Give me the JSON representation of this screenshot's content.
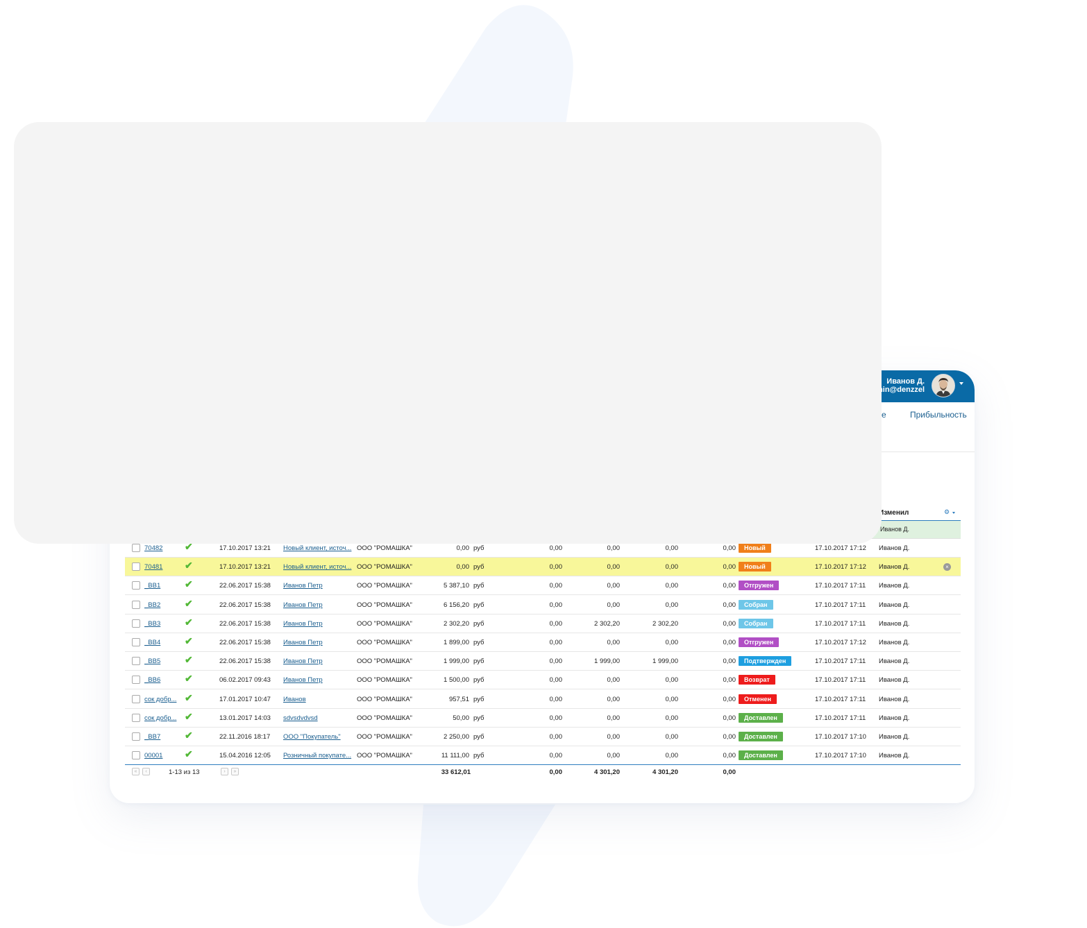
{
  "user": {
    "name": "Иванов Д.",
    "email": "min@denzzel"
  },
  "nav": {
    "partial_item": "е",
    "profit": "Прибыльность"
  },
  "table": {
    "changed_by_header": "Изменил",
    "first_row_user": "Иванов Д.",
    "rows": [
      {
        "id": "70482",
        "date": "17.10.2017 13:21",
        "client": "Новый клиент, источ...",
        "org": "ООО \"РОМАШКА\"",
        "amount": "0,00",
        "cur": "руб",
        "c1": "0,00",
        "c2": "0,00",
        "c3": "0,00",
        "c4": "0,00",
        "status": "Новый",
        "status_color": "#f07f1a",
        "modified": "17.10.2017 17:12",
        "user": "Иванов Д.",
        "highlight": false
      },
      {
        "id": "70481",
        "date": "17.10.2017 13:21",
        "client": "Новый клиент, источ...",
        "org": "ООО \"РОМАШКА\"",
        "amount": "0,00",
        "cur": "руб",
        "c1": "0,00",
        "c2": "0,00",
        "c3": "0,00",
        "c4": "0,00",
        "status": "Новый",
        "status_color": "#f07f1a",
        "modified": "17.10.2017 17:12",
        "user": "Иванов Д.",
        "highlight": true
      },
      {
        "id": "_BB1",
        "date": "22.06.2017 15:38",
        "client": "Иванов Петр",
        "org": "ООО \"РОМАШКА\"",
        "amount": "5 387,10",
        "cur": "руб",
        "c1": "0,00",
        "c2": "0,00",
        "c3": "0,00",
        "c4": "0,00",
        "status": "Отгружен",
        "status_color": "#b14fc5",
        "modified": "17.10.2017 17:11",
        "user": "Иванов Д.",
        "highlight": false
      },
      {
        "id": "_BB2",
        "date": "22.06.2017 15:38",
        "client": "Иванов Петр",
        "org": "ООО \"РОМАШКА\"",
        "amount": "6 156,20",
        "cur": "руб",
        "c1": "0,00",
        "c2": "0,00",
        "c3": "0,00",
        "c4": "0,00",
        "status": "Собран",
        "status_color": "#6ec6e8",
        "modified": "17.10.2017 17:11",
        "user": "Иванов Д.",
        "highlight": false
      },
      {
        "id": "_BB3",
        "date": "22.06.2017 15:38",
        "client": "Иванов Петр",
        "org": "ООО \"РОМАШКА\"",
        "amount": "2 302,20",
        "cur": "руб",
        "c1": "0,00",
        "c2": "2 302,20",
        "c3": "2 302,20",
        "c4": "0,00",
        "status": "Собран",
        "status_color": "#6ec6e8",
        "modified": "17.10.2017 17:11",
        "user": "Иванов Д.",
        "highlight": false
      },
      {
        "id": "_BB4",
        "date": "22.06.2017 15:38",
        "client": "Иванов Петр",
        "org": "ООО \"РОМАШКА\"",
        "amount": "1 899,00",
        "cur": "руб",
        "c1": "0,00",
        "c2": "0,00",
        "c3": "0,00",
        "c4": "0,00",
        "status": "Отгружен",
        "status_color": "#b14fc5",
        "modified": "17.10.2017 17:12",
        "user": "Иванов Д.",
        "highlight": false
      },
      {
        "id": "_BB5",
        "date": "22.06.2017 15:38",
        "client": "Иванов Петр",
        "org": "ООО \"РОМАШКА\"",
        "amount": "1 999,00",
        "cur": "руб",
        "c1": "0,00",
        "c2": "1 999,00",
        "c3": "1 999,00",
        "c4": "0,00",
        "status": "Подтвержден",
        "status_color": "#1e9fe0",
        "modified": "17.10.2017 17:11",
        "user": "Иванов Д.",
        "highlight": false
      },
      {
        "id": "_BB6",
        "date": "06.02.2017 09:43",
        "client": "Иванов Петр",
        "org": "ООО \"РОМАШКА\"",
        "amount": "1 500,00",
        "cur": "руб",
        "c1": "0,00",
        "c2": "0,00",
        "c3": "0,00",
        "c4": "0,00",
        "status": "Возврат",
        "status_color": "#ee1c1c",
        "modified": "17.10.2017 17:11",
        "user": "Иванов Д.",
        "highlight": false
      },
      {
        "id": "сок добр...",
        "date": "17.01.2017 10:47",
        "client": "Иванов",
        "org": "ООО \"РОМАШКА\"",
        "amount": "957,51",
        "cur": "руб",
        "c1": "0,00",
        "c2": "0,00",
        "c3": "0,00",
        "c4": "0,00",
        "status": "Отменен",
        "status_color": "#ee1c1c",
        "modified": "17.10.2017 17:11",
        "user": "Иванов Д.",
        "highlight": false
      },
      {
        "id": "сок добр...",
        "date": "13.01.2017 14:03",
        "client": "sdvsdvdvsd",
        "org": "ООО \"РОМАШКА\"",
        "amount": "50,00",
        "cur": "руб",
        "c1": "0,00",
        "c2": "0,00",
        "c3": "0,00",
        "c4": "0,00",
        "status": "Доставлен",
        "status_color": "#5cb04a",
        "modified": "17.10.2017 17:11",
        "user": "Иванов Д.",
        "highlight": false
      },
      {
        "id": "_BB7",
        "date": "22.11.2016 18:17",
        "client": "ООО \"Покупатель\"",
        "org": "ООО \"РОМАШКА\"",
        "amount": "2 250,00",
        "cur": "руб",
        "c1": "0,00",
        "c2": "0,00",
        "c3": "0,00",
        "c4": "0,00",
        "status": "Доставлен",
        "status_color": "#5cb04a",
        "modified": "17.10.2017 17:10",
        "user": "Иванов Д.",
        "highlight": false
      },
      {
        "id": "00001",
        "date": "15.04.2016 12:05",
        "client": "Розничный покупате...",
        "org": "ООО \"РОМАШКА\"",
        "amount": "11 111,00",
        "cur": "руб",
        "c1": "0,00",
        "c2": "0,00",
        "c3": "0,00",
        "c4": "0,00",
        "status": "Доставлен",
        "status_color": "#5cb04a",
        "modified": "17.10.2017 17:10",
        "user": "Иванов Д.",
        "highlight": false
      }
    ],
    "totals": {
      "amount": "33 612,01",
      "c1": "0,00",
      "c2": "4 301,20",
      "c3": "4 301,20",
      "c4": "0,00"
    },
    "pager": "1-13 из 13"
  },
  "icons": {
    "check": "checkmark-icon",
    "gear": "gear-icon",
    "clear": "clear-icon",
    "pager_first": "pager-first-icon",
    "pager_prev": "pager-prev-icon",
    "pager_next": "pager-next-icon",
    "pager_last": "pager-last-icon"
  },
  "colors": {
    "topbar": "#0a6aa6",
    "link": "#1a5e8f",
    "highlight_row": "#f8f79a",
    "first_row": "#dff1df",
    "overlay": "#f4f4f4"
  }
}
